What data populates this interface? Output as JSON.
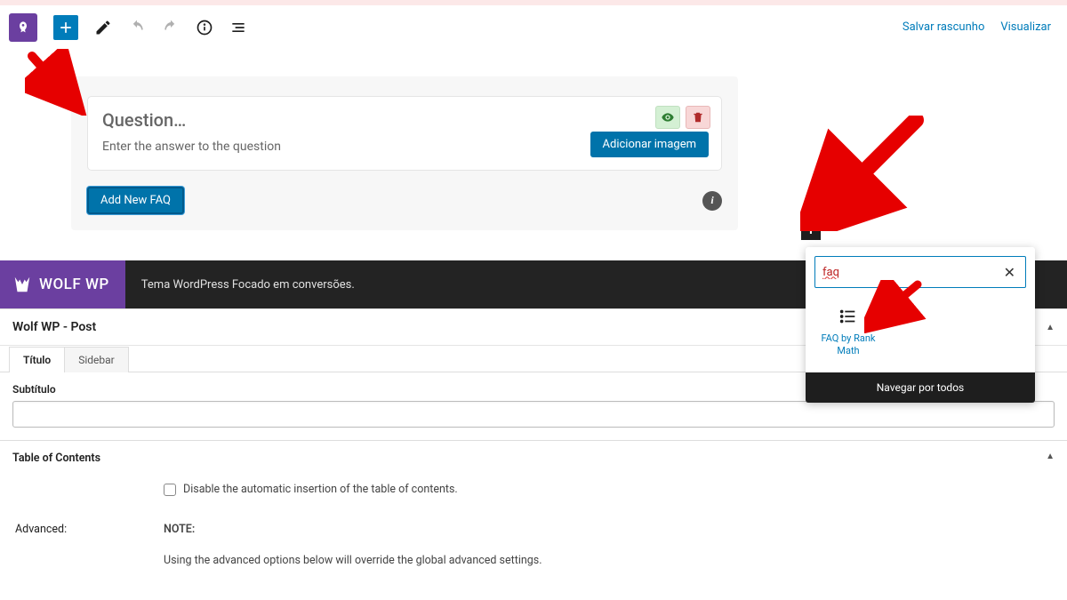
{
  "toolbar": {
    "save_draft": "Salvar rascunho",
    "preview": "Visualizar"
  },
  "faq": {
    "question_placeholder": "Question…",
    "answer_placeholder": "Enter the answer to the question",
    "add_image": "Adicionar imagem",
    "add_new": "Add New FAQ"
  },
  "wolf": {
    "brand": "WOLF WP",
    "tagline": "Tema WordPress Focado em conversões."
  },
  "metabox": {
    "title": "Wolf WP - Post",
    "tab_titulo": "Título",
    "tab_sidebar": "Sidebar",
    "subtitulo_label": "Subtítulo"
  },
  "toc": {
    "header": "Table of Contents",
    "disable_label": "Disable the automatic insertion of the table of contents.",
    "advanced_label": "Advanced:",
    "note_label": "NOTE:",
    "note_text": "Using the advanced options below will override the global advanced settings."
  },
  "inserter": {
    "search_value": "faq",
    "block_label": "FAQ by Rank Math",
    "browse_all": "Navegar por todos"
  }
}
